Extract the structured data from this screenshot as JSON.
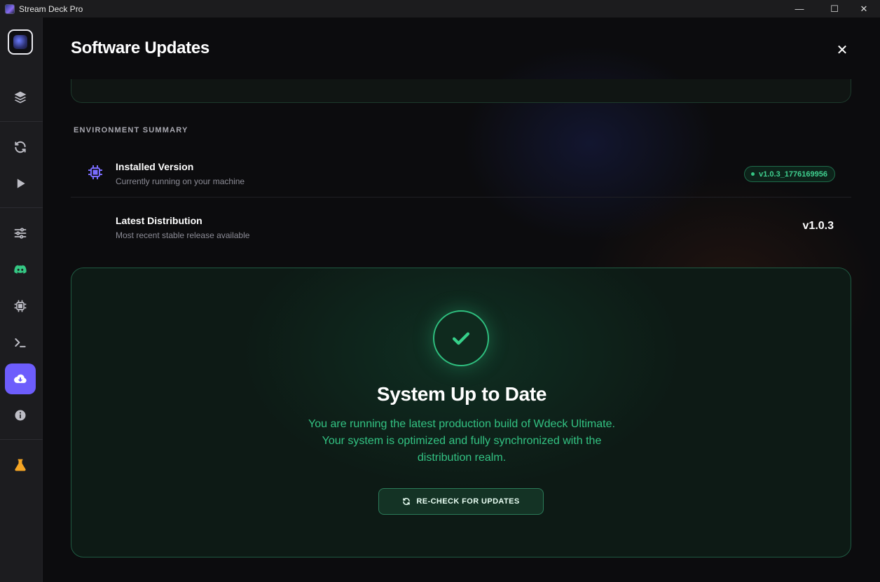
{
  "window": {
    "title": "Stream Deck Pro",
    "controls": {
      "minimize": "—",
      "maximize": "☐",
      "close": "✕"
    }
  },
  "sidebar": {
    "logo": "app-logo",
    "items": [
      {
        "icon": "layers-icon",
        "active": false
      },
      {
        "icon": "refresh-icon",
        "active": false
      },
      {
        "icon": "play-icon",
        "active": false
      },
      {
        "icon": "sliders-icon",
        "active": false
      },
      {
        "icon": "discord-icon",
        "active": false,
        "color": "#35c884"
      },
      {
        "icon": "chip-icon",
        "active": false
      },
      {
        "icon": "terminal-icon",
        "active": false
      },
      {
        "icon": "cloud-download-icon",
        "active": true,
        "color": "#6d5dfc"
      },
      {
        "icon": "info-icon",
        "active": false
      },
      {
        "icon": "flask-icon",
        "active": false,
        "color": "#f5a524"
      }
    ]
  },
  "page": {
    "title": "Software Updates",
    "close_label": "✕"
  },
  "environment": {
    "section_label": "ENVIRONMENT SUMMARY",
    "installed": {
      "title": "Installed Version",
      "subtitle": "Currently running on your machine",
      "version": "v1.0.3_1776169956"
    },
    "latest": {
      "title": "Latest Distribution",
      "subtitle": "Most recent stable release available",
      "version": "v1.0.3"
    }
  },
  "status": {
    "title": "System Up to Date",
    "description": "You are running the latest production build of Wdeck Ultimate. Your system is optimized and fully synchronized with the distribution realm.",
    "button_label": "RE-CHECK FOR UPDATES",
    "accent": "#33c383"
  }
}
